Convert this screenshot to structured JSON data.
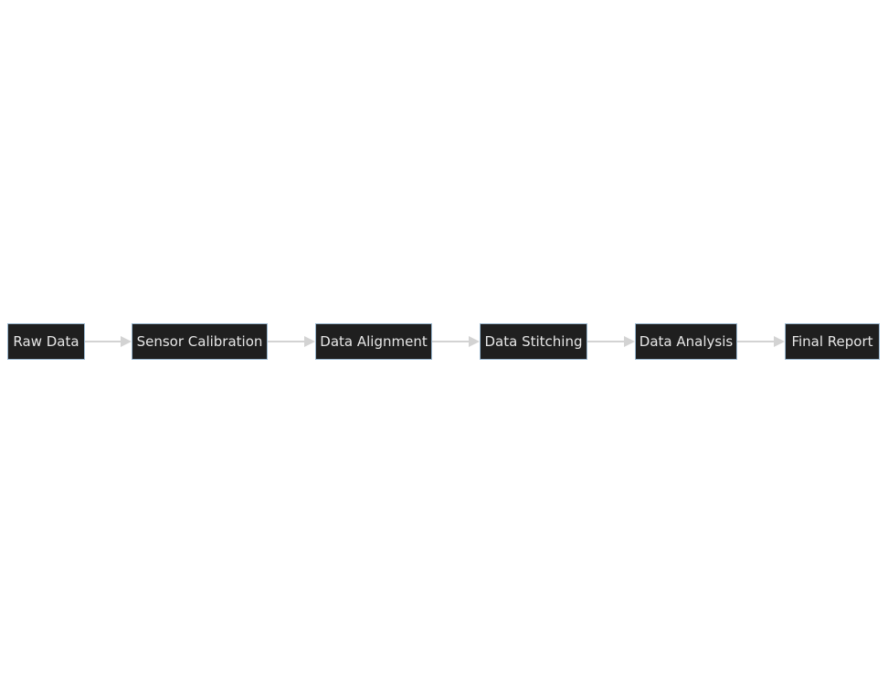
{
  "nodes": [
    {
      "id": "raw",
      "label": "Raw Data"
    },
    {
      "id": "calib",
      "label": "Sensor Calibration"
    },
    {
      "id": "align",
      "label": "Data Alignment"
    },
    {
      "id": "stitch",
      "label": "Data Stitching"
    },
    {
      "id": "analysis",
      "label": "Data Analysis"
    },
    {
      "id": "report",
      "label": "Final Report"
    }
  ],
  "edges": [
    {
      "from": "raw",
      "to": "calib"
    },
    {
      "from": "calib",
      "to": "align"
    },
    {
      "from": "align",
      "to": "stitch"
    },
    {
      "from": "stitch",
      "to": "analysis"
    },
    {
      "from": "analysis",
      "to": "report"
    }
  ],
  "colors": {
    "node_fill": "#1f1f1f",
    "node_border": "#9ab8d0",
    "node_text": "#e6e6e6",
    "edge": "#d3d3d3"
  }
}
